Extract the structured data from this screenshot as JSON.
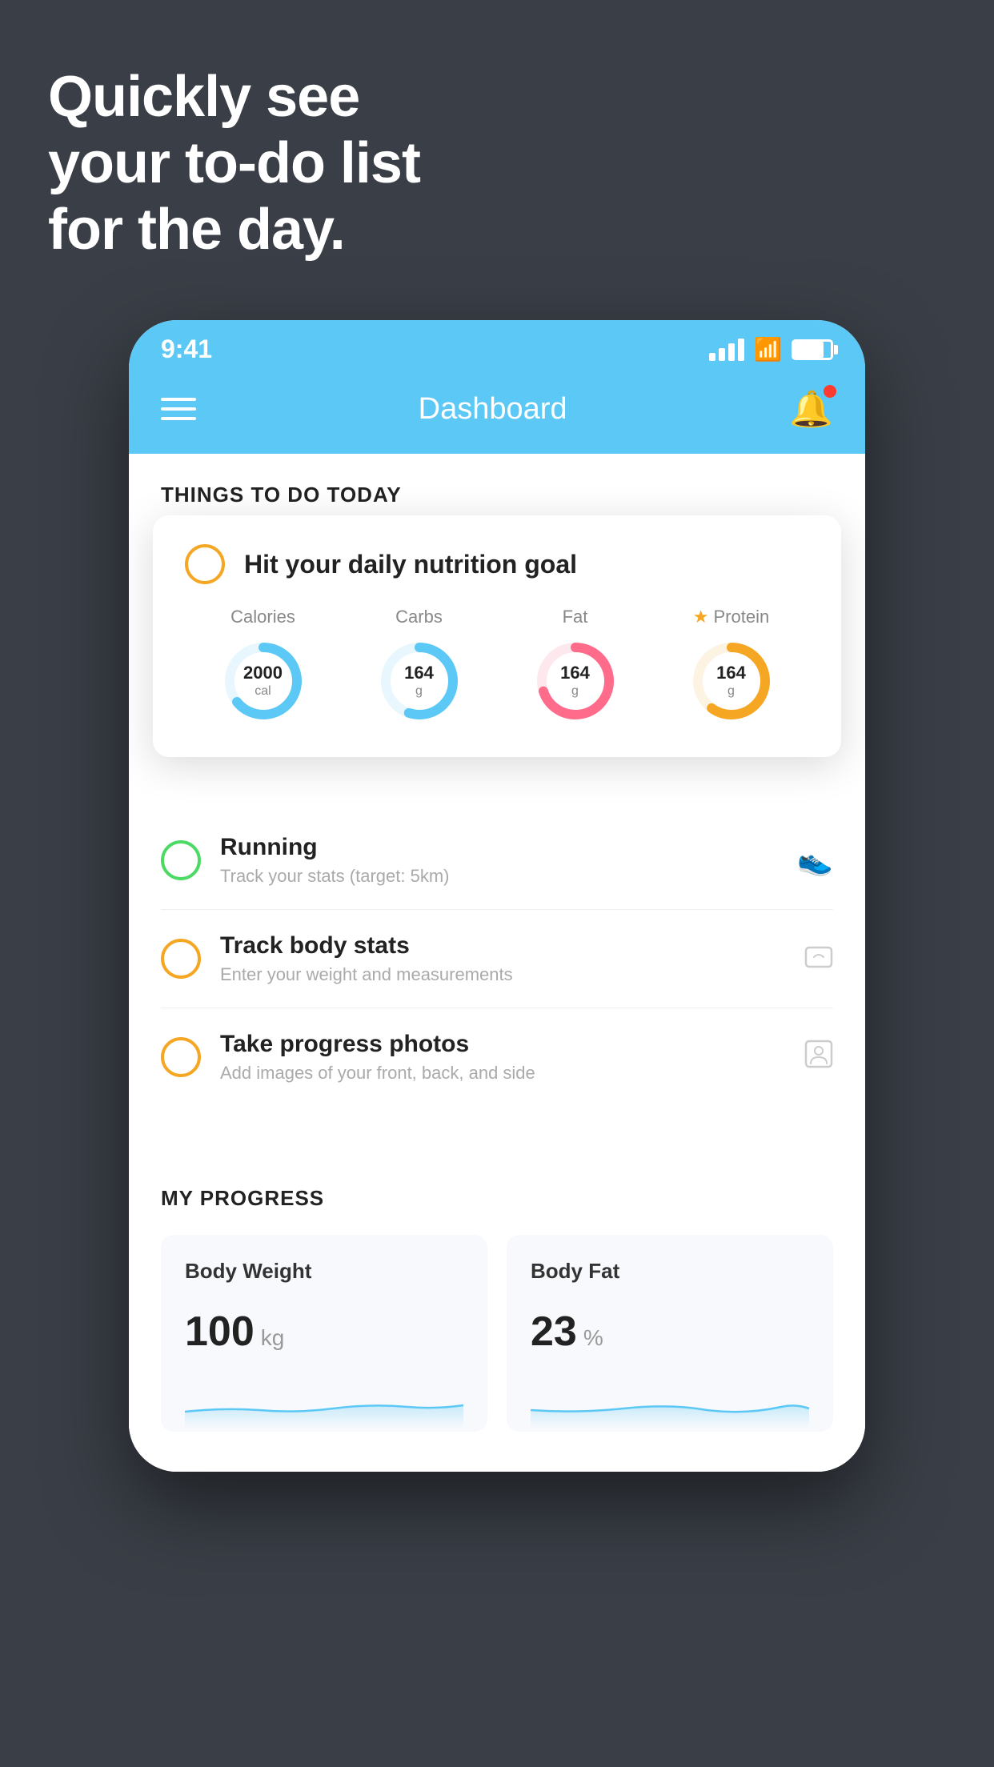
{
  "hero": {
    "line1": "Quickly see",
    "line2": "your to-do list",
    "line3": "for the day."
  },
  "statusBar": {
    "time": "9:41",
    "signalBars": [
      10,
      16,
      22,
      28
    ],
    "batteryPercent": 80
  },
  "header": {
    "title": "Dashboard",
    "menuLabel": "menu",
    "bellLabel": "notifications"
  },
  "thingsToDoSection": {
    "heading": "THINGS TO DO TODAY"
  },
  "nutritionCard": {
    "title": "Hit your daily nutrition goal",
    "stats": [
      {
        "label": "Calories",
        "value": "2000",
        "unit": "cal",
        "color": "#5bc8f5",
        "percent": 65
      },
      {
        "label": "Carbs",
        "value": "164",
        "unit": "g",
        "color": "#5bc8f5",
        "percent": 55
      },
      {
        "label": "Fat",
        "value": "164",
        "unit": "g",
        "color": "#ff6b8a",
        "percent": 70
      },
      {
        "label": "Protein",
        "value": "164",
        "unit": "g",
        "color": "#f5a623",
        "percent": 60,
        "starred": true
      }
    ]
  },
  "todoItems": [
    {
      "title": "Running",
      "subtitle": "Track your stats (target: 5km)",
      "circleColor": "green",
      "icon": "shoe"
    },
    {
      "title": "Track body stats",
      "subtitle": "Enter your weight and measurements",
      "circleColor": "orange",
      "icon": "scale"
    },
    {
      "title": "Take progress photos",
      "subtitle": "Add images of your front, back, and side",
      "circleColor": "orange",
      "icon": "person"
    }
  ],
  "progressSection": {
    "heading": "MY PROGRESS",
    "cards": [
      {
        "title": "Body Weight",
        "value": "100",
        "unit": "kg"
      },
      {
        "title": "Body Fat",
        "value": "23",
        "unit": "%"
      }
    ]
  },
  "colors": {
    "background": "#3a3f47",
    "headerBlue": "#5bc8f5",
    "white": "#ffffff",
    "greenCircle": "#4cd964",
    "orangeCircle": "#f5a623",
    "pinkDonut": "#ff6b8a"
  }
}
